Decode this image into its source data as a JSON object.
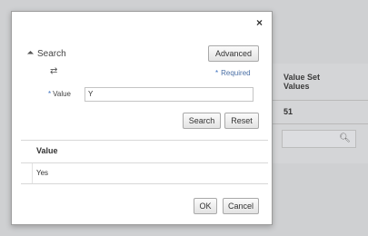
{
  "background": {
    "column_header": "Value Set Values",
    "cell_value": "51",
    "search_icon": "magnifier-icon"
  },
  "dialog": {
    "close_glyph": "×",
    "search_section_label": "Search",
    "advanced_button": "Advanced",
    "required_star": "*",
    "required_label": "Required",
    "value_label": "Value",
    "value_input": "Y",
    "search_button": "Search",
    "reset_button": "Reset",
    "results": {
      "column": "Value",
      "rows": [
        "Yes"
      ]
    },
    "ok_button": "OK",
    "cancel_button": "Cancel"
  }
}
